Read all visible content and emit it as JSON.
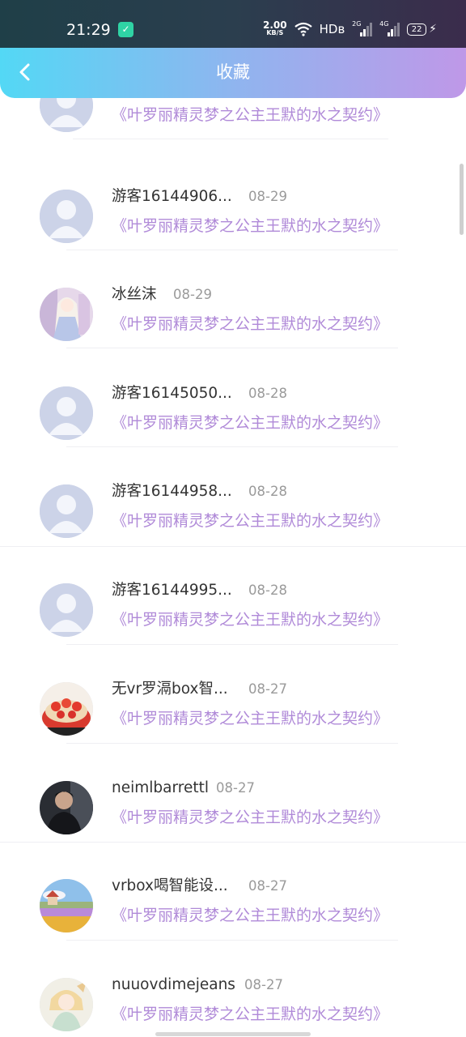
{
  "status_bar": {
    "time": "21:29",
    "app_icon": "app-notification-icon",
    "net_speed_value": "2.00",
    "net_speed_unit": "KB/S",
    "hd_label": "HDʙ",
    "signal1_label": "2G",
    "signal2_label": "4G",
    "battery_level": "22"
  },
  "header": {
    "title": "收藏",
    "back_icon": "chevron-left-icon"
  },
  "items": [
    {
      "name": "",
      "date": "",
      "book": "《叶罗丽精灵梦之公主王默的水之契约》",
      "avatar": "default"
    },
    {
      "name": "游客16144906...",
      "date": "08-29",
      "book": "《叶罗丽精灵梦之公主王默的水之契约》",
      "avatar": "default"
    },
    {
      "name": "冰丝沫",
      "date": "08-29",
      "book": "《叶罗丽精灵梦之公主王默的水之契约》",
      "avatar": "anime-girl"
    },
    {
      "name": "游客16145050...",
      "date": "08-28",
      "book": "《叶罗丽精灵梦之公主王默的水之契约》",
      "avatar": "default"
    },
    {
      "name": "游客16144958...",
      "date": "08-28",
      "book": "《叶罗丽精灵梦之公主王默的水之契约》",
      "avatar": "default"
    },
    {
      "name": "游客16144995...",
      "date": "08-28",
      "book": "《叶罗丽精灵梦之公主王默的水之契约》",
      "avatar": "default"
    },
    {
      "name": "无vr罗滆box智...",
      "date": "08-27",
      "book": "《叶罗丽精灵梦之公主王默的水之契约》",
      "avatar": "cake"
    },
    {
      "name": "neimlbarrettl",
      "date": "08-27",
      "book": "《叶罗丽精灵梦之公主王默的水之契约》",
      "avatar": "man-photo"
    },
    {
      "name": "vrbox喝智能设...",
      "date": "08-27",
      "book": "《叶罗丽精灵梦之公主王默的水之契约》",
      "avatar": "landscape"
    },
    {
      "name": "nuuovdimejeans",
      "date": "08-27",
      "book": "《叶罗丽精灵梦之公主王默的水之契约》",
      "avatar": "anime-fox-girl"
    }
  ]
}
